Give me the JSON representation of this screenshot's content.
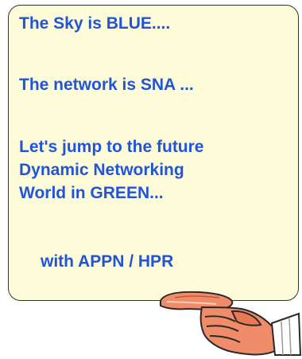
{
  "note": {
    "lines": [
      "The Sky is BLUE....",
      "The network is SNA ...",
      "Let's jump to the future",
      "Dynamic Networking",
      "World in GREEN...",
      "with APPN / HPR"
    ]
  },
  "colors": {
    "text": "#1f55d6",
    "card_fill": "#fdfbd8",
    "card_border": "#333333",
    "hand_skin": "#f08c6a",
    "cuff": "#ffffff"
  },
  "icons": {
    "pointer": "pointing-hand-icon"
  }
}
